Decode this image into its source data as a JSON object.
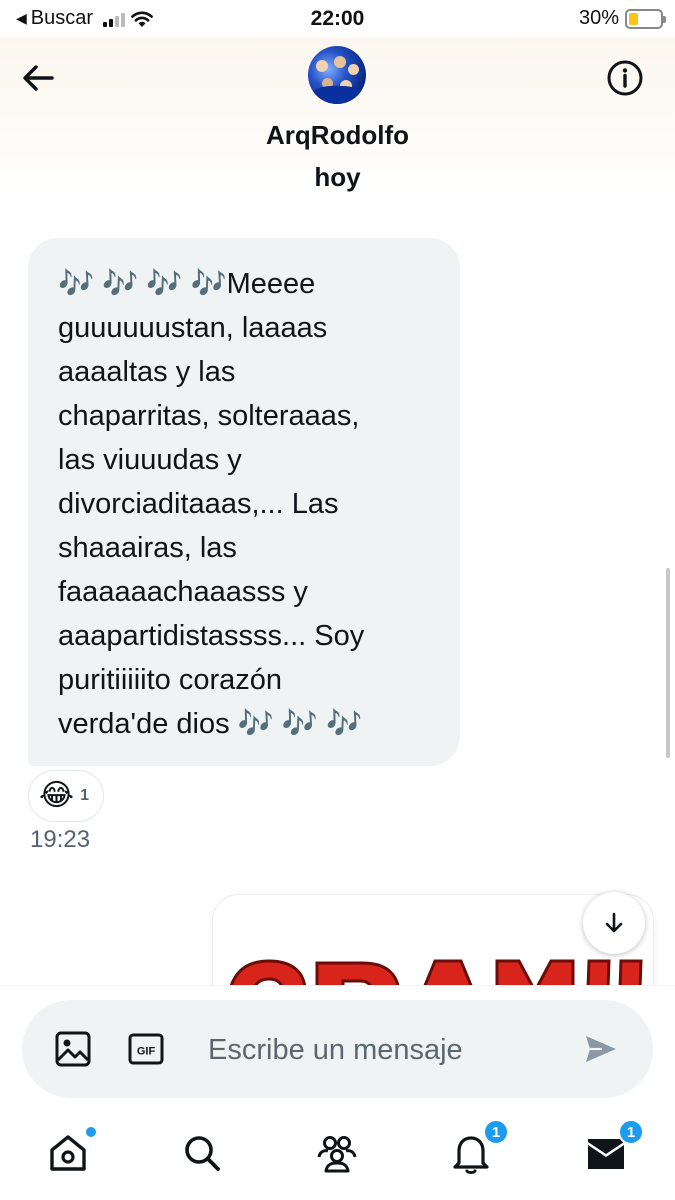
{
  "status_bar": {
    "back_app": "Buscar",
    "time": "22:00",
    "battery": "30%",
    "battery_level": 0.3
  },
  "header": {
    "contact_name": "ArqRodolfo",
    "day_label": "hoy",
    "back_icon": "arrow-left-icon",
    "info_icon": "info-icon"
  },
  "message": {
    "text": "🎶 🎶 🎶 🎶Meeee guuuuuustan, laaaas aaaaltas y las chaparritas, solteraaas, las viuuudas y divorciaditaaas,... Las shaaairas, las faaaaaachaaasss y aaapartidistassss... Soy puritiiiiito corazón verda'de dios 🎶 🎶 🎶",
    "lines": [
      "🎶 🎶 🎶 🎶Meeee",
      "guuuuuustan, laaaas",
      "aaaaltas y las",
      "chaparritas, solteraaas,",
      "las viuuudas y",
      "divorciaditaaas,... Las",
      "shaaairas, las",
      "faaaaaachaaasss y",
      "aaapartidistassss... Soy",
      "puritiiiiito corazón",
      "verda'de dios 🎶 🎶 🎶"
    ],
    "reaction_emoji": "😂",
    "reaction_count": "1",
    "time": "19:23"
  },
  "composer": {
    "placeholder": "Escribe un mensaje",
    "media_icon": "image-icon",
    "gif_label": "GIF",
    "send_icon": "send-icon"
  },
  "tabbar": {
    "items": [
      {
        "name": "home",
        "icon": "home-icon",
        "badge": ""
      },
      {
        "name": "search",
        "icon": "search-icon",
        "badge": ""
      },
      {
        "name": "communities",
        "icon": "communities-icon",
        "badge": ""
      },
      {
        "name": "notifications",
        "icon": "bell-icon",
        "badge": "1"
      },
      {
        "name": "messages",
        "icon": "mail-icon",
        "badge": "1"
      }
    ]
  },
  "colors": {
    "accent": "#1d9bf0",
    "bubble_bg": "#eff3f4",
    "secondary_text": "#536471",
    "image_red": "#d9241c"
  }
}
